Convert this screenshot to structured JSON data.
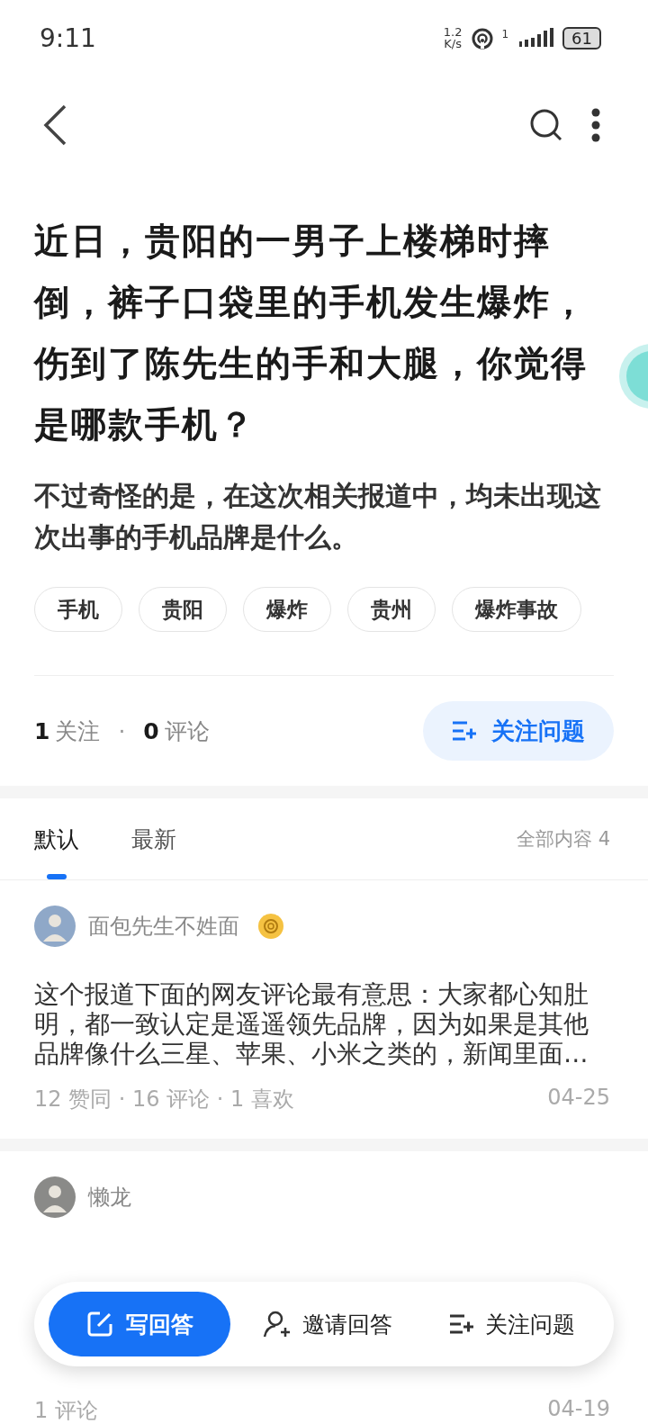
{
  "status_bar": {
    "time": "9:11",
    "net_speed_value": "1.2",
    "net_speed_unit": "K/s",
    "hotspot_badge": "1",
    "battery": "61"
  },
  "question": {
    "title": "近日，贵阳的一男子上楼梯时摔倒，裤子口袋里的手机发生爆炸，伤到了陈先生的手和大腿，你觉得是哪款手机？",
    "detail": "不过奇怪的是，在这次相关报道中，均未出现这次出事的手机品牌是什么。",
    "tags": [
      "手机",
      "贵阳",
      "爆炸",
      "贵州",
      "爆炸事故"
    ],
    "followers": "1",
    "followers_label": "关注",
    "separator": "·",
    "comments": "0",
    "comments_label": "评论",
    "follow_button": "关注问题"
  },
  "tabs": [
    {
      "label": "默认",
      "selected": true
    },
    {
      "label": "最新",
      "selected": false
    }
  ],
  "total": "全部内容 4",
  "answers": [
    {
      "author": "面包先生不姓面",
      "badge": true,
      "excerpt": "这个报道下面的网友评论最有意思：大家都心知肚明，都一致认定是遥遥领先品牌，因为如果是其他品牌像什么三星、苹果、小米之类的，新闻里面…",
      "stats": "12  赞同 · 16  评论 · 1  喜欢",
      "date": "04-25"
    },
    {
      "author": "懒龙",
      "badge": false,
      "stats": "1  评论",
      "date": "04-19"
    }
  ],
  "bottom_bar": {
    "write": "写回答",
    "invite": "邀请回答",
    "follow": "关注问题"
  }
}
